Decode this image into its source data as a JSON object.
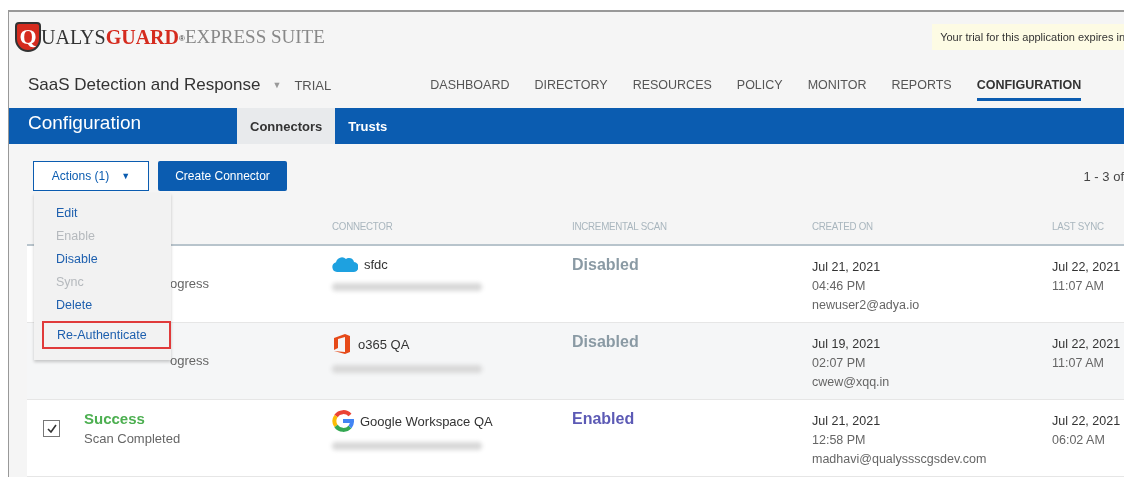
{
  "logo": {
    "initial": "Q",
    "name": "UALYS",
    "brand": "GUARD",
    "mark": "®",
    "suffix": "EXPRESS SUITE"
  },
  "trial_notice": "Your trial for this application expires in",
  "product": {
    "name": "SaaS Detection and Response",
    "caret": "▼",
    "badge": "TRIAL"
  },
  "nav": [
    {
      "label": "DASHBOARD",
      "selected": false
    },
    {
      "label": "DIRECTORY",
      "selected": false
    },
    {
      "label": "RESOURCES",
      "selected": false
    },
    {
      "label": "POLICY",
      "selected": false
    },
    {
      "label": "MONITOR",
      "selected": false
    },
    {
      "label": "REPORTS",
      "selected": false
    },
    {
      "label": "CONFIGURATION",
      "selected": true
    }
  ],
  "page_title": "Configuration",
  "tabs": [
    {
      "label": "Connectors",
      "selected": true
    },
    {
      "label": "Trusts",
      "selected": false
    }
  ],
  "toolbar": {
    "actions": "Actions (1)",
    "actions_caret": "▼",
    "create": "Create Connector",
    "pagination": "1 - 3 of"
  },
  "actions_menu": [
    {
      "label": "Edit",
      "disabled": false,
      "highlighted": false
    },
    {
      "label": "Enable",
      "disabled": true,
      "highlighted": false
    },
    {
      "label": "Disable",
      "disabled": false,
      "highlighted": false
    },
    {
      "label": "Sync",
      "disabled": true,
      "highlighted": false
    },
    {
      "label": "Delete",
      "disabled": false,
      "highlighted": false
    },
    {
      "label": "Re-Authenticate",
      "disabled": false,
      "highlighted": true
    }
  ],
  "table": {
    "columns": [
      "CONNECTOR",
      "INCREMENTAL SCAN",
      "CREATED ON",
      "LAST SYNC"
    ],
    "rows": [
      {
        "detail": "ogress",
        "connector": {
          "kind": "cloud",
          "name": "sfdc"
        },
        "incremental": {
          "label": "Disabled",
          "enabled": false
        },
        "created": [
          "Jul 21, 2021",
          "04:46 PM",
          "newuser2@adya.io"
        ],
        "last_sync": [
          "Jul 22, 2021",
          "11:07 AM"
        ]
      },
      {
        "detail": "ogress",
        "connector": {
          "kind": "office",
          "name": "o365 QA"
        },
        "incremental": {
          "label": "Disabled",
          "enabled": false
        },
        "created": [
          "Jul 19, 2021",
          "02:07 PM",
          "cwew@xqq.in"
        ],
        "last_sync": [
          "Jul 22, 2021",
          "11:07 AM"
        ]
      },
      {
        "checked": true,
        "status": "Success",
        "detail": "Scan Completed",
        "connector": {
          "kind": "g",
          "name": "Google Workspace QA"
        },
        "incremental": {
          "label": "Enabled",
          "enabled": true
        },
        "created": [
          "Jul 21, 2021",
          "12:58 PM",
          "madhavi@qualyssscgsdev.com"
        ],
        "last_sync": [
          "Jul 22, 2021",
          "06:02 AM"
        ]
      }
    ]
  }
}
